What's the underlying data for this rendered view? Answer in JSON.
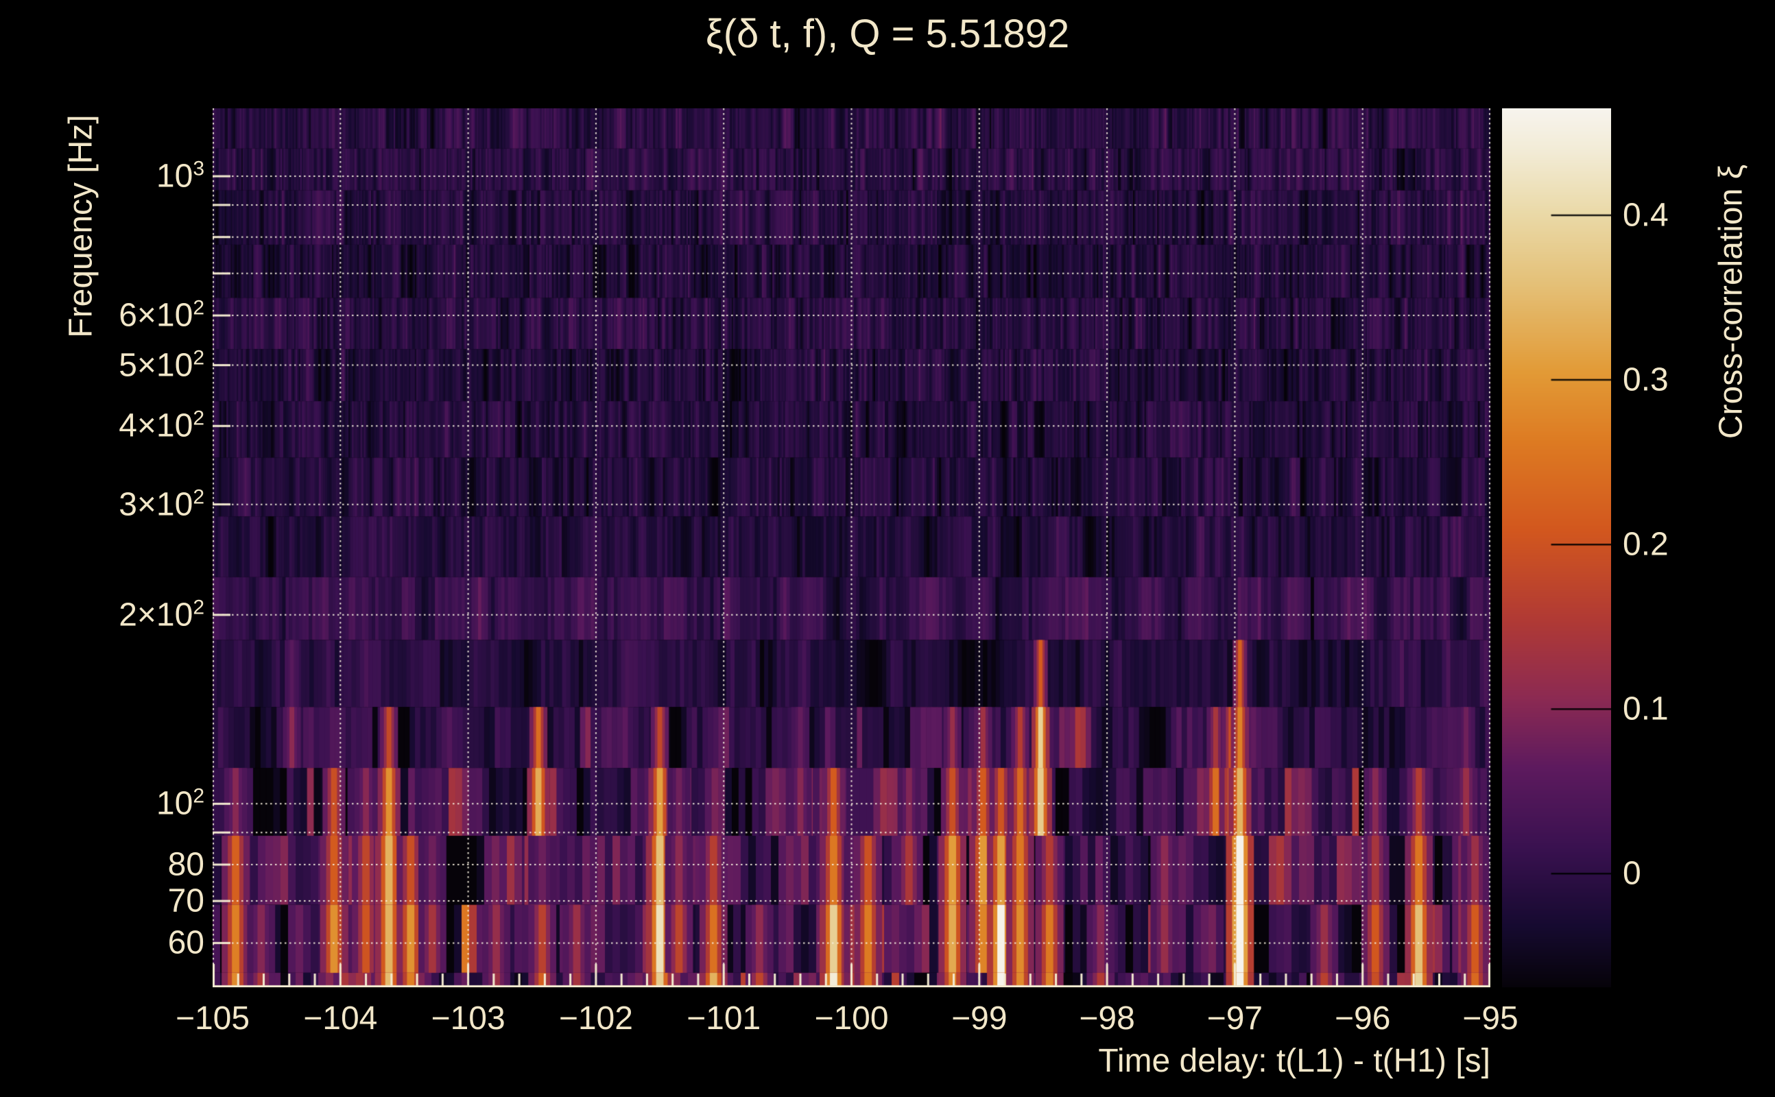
{
  "chart_data": {
    "type": "heatmap",
    "title": "ξ(δ t, f), Q = 5.51892",
    "xlabel": "Time delay: t(L1) - t(H1) [s]",
    "ylabel": "Frequency [Hz]",
    "x_range": [
      -105.0,
      -95.0
    ],
    "x_ticks": [
      {
        "t": -105,
        "label": "−105"
      },
      {
        "t": -104,
        "label": "−104"
      },
      {
        "t": -103,
        "label": "−103"
      },
      {
        "t": -102,
        "label": "−102"
      },
      {
        "t": -101,
        "label": "−101"
      },
      {
        "t": -100,
        "label": "−100"
      },
      {
        "t": -99,
        "label": "−99"
      },
      {
        "t": -98,
        "label": "−98"
      },
      {
        "t": -97,
        "label": "−97"
      },
      {
        "t": -96,
        "label": "−96"
      },
      {
        "t": -95,
        "label": "−95"
      }
    ],
    "x_minor_step": 0.2,
    "y_scale": "log",
    "y_range_hz": [
      51,
      1283
    ],
    "y_ticks": [
      {
        "f": 1000,
        "m": "10",
        "e": "3"
      },
      {
        "f": 600,
        "m": "6×10",
        "e": "2"
      },
      {
        "f": 500,
        "m": "5×10",
        "e": "2"
      },
      {
        "f": 400,
        "m": "4×10",
        "e": "2"
      },
      {
        "f": 300,
        "m": "3×10",
        "e": "2"
      },
      {
        "f": 200,
        "m": "2×10",
        "e": "2"
      },
      {
        "f": 100,
        "m": "10",
        "e": "2"
      },
      {
        "f": 80,
        "m": "80",
        "e": null
      },
      {
        "f": 70,
        "m": "70",
        "e": null
      },
      {
        "f": 60,
        "m": "60",
        "e": null
      }
    ],
    "y_gridlines_hz": [
      1000,
      900,
      800,
      700,
      600,
      500,
      400,
      300,
      200,
      100,
      90,
      80,
      70,
      60
    ],
    "grid_on": true,
    "colorbar": {
      "label": "Cross-correlation ξ",
      "ticks": [
        {
          "v": 0.0,
          "label": "0"
        },
        {
          "v": 0.1,
          "label": "0.1"
        },
        {
          "v": 0.2,
          "label": "0.2"
        },
        {
          "v": 0.3,
          "label": "0.3"
        },
        {
          "v": 0.4,
          "label": "0.4"
        }
      ],
      "vmin": -0.069,
      "vmax": 0.465
    },
    "colormap_stops": [
      [
        0.0,
        "#060309"
      ],
      [
        0.07,
        "#160a30"
      ],
      [
        0.16,
        "#3a1150"
      ],
      [
        0.25,
        "#5d1a5e"
      ],
      [
        0.33,
        "#8c2a52"
      ],
      [
        0.42,
        "#b13a34"
      ],
      [
        0.52,
        "#d2571e"
      ],
      [
        0.62,
        "#dd7a22"
      ],
      [
        0.7,
        "#e29a36"
      ],
      [
        0.8,
        "#e4c077"
      ],
      [
        0.88,
        "#ead9a7"
      ],
      [
        0.95,
        "#f2ebd5"
      ],
      [
        1.0,
        "#f7f4ee"
      ]
    ],
    "noise": {
      "seed": 1337,
      "base": -0.012,
      "sigma_high": 0.02,
      "sigma_mid": 0.035,
      "sigma_low": 0.052
    },
    "streaks": [
      {
        "t": -104.82,
        "f": [
          51,
          100
        ],
        "v": 0.26
      },
      {
        "t": -104.62,
        "f": [
          51,
          64
        ],
        "v": 0.16
      },
      {
        "t": -104.38,
        "f": [
          120,
          170
        ],
        "v": 0.1
      },
      {
        "t": -104.05,
        "f": [
          55,
          112
        ],
        "v": 0.28
      },
      {
        "t": -103.8,
        "f": [
          62,
          95
        ],
        "v": 0.22
      },
      {
        "t": -103.62,
        "f": [
          51,
          132
        ],
        "v": 0.4
      },
      {
        "t": -103.45,
        "f": [
          51,
          88
        ],
        "v": 0.3
      },
      {
        "t": -103.28,
        "f": [
          56,
          80
        ],
        "v": 0.16
      },
      {
        "t": -102.78,
        "f": [
          51,
          66
        ],
        "v": 0.15
      },
      {
        "t": -102.45,
        "f": [
          78,
          142
        ],
        "v": 0.38
      },
      {
        "t": -102.42,
        "f": [
          51,
          70
        ],
        "v": 0.2
      },
      {
        "t": -102.15,
        "f": [
          51,
          66
        ],
        "v": 0.16
      },
      {
        "t": -101.5,
        "f": [
          51,
          128
        ],
        "v": 0.4
      },
      {
        "t": -101.35,
        "f": [
          60,
          92
        ],
        "v": 0.16
      },
      {
        "t": -101.08,
        "f": [
          51,
          80
        ],
        "v": 0.3
      },
      {
        "t": -100.72,
        "f": [
          51,
          66
        ],
        "v": 0.16
      },
      {
        "t": -100.4,
        "f": [
          95,
          130
        ],
        "v": 0.12
      },
      {
        "t": -100.14,
        "f": [
          51,
          92
        ],
        "v": 0.42
      },
      {
        "t": -99.95,
        "f": [
          51,
          72
        ],
        "v": 0.24
      },
      {
        "t": -99.87,
        "f": [
          51,
          86
        ],
        "v": 0.28
      },
      {
        "t": -99.55,
        "f": [
          70,
          112
        ],
        "v": 0.15
      },
      {
        "t": -99.21,
        "f": [
          51,
          122
        ],
        "v": 0.32
      },
      {
        "t": -98.97,
        "f": [
          58,
          132
        ],
        "v": 0.3
      },
      {
        "t": -98.83,
        "f": [
          51,
          96
        ],
        "v": 0.46
      },
      {
        "t": -98.68,
        "f": [
          51,
          140
        ],
        "v": 0.28
      },
      {
        "t": -98.52,
        "f": [
          92,
          160
        ],
        "v": 0.44
      },
      {
        "t": -98.45,
        "f": [
          51,
          82
        ],
        "v": 0.28
      },
      {
        "t": -98.05,
        "f": [
          51,
          64
        ],
        "v": 0.14
      },
      {
        "t": -97.55,
        "f": [
          60,
          92
        ],
        "v": 0.13
      },
      {
        "t": -97.15,
        "f": [
          95,
          140
        ],
        "v": 0.22
      },
      {
        "t": -97.03,
        "f": [
          100,
          142
        ],
        "v": 0.24
      },
      {
        "t": -96.96,
        "f": [
          51,
          148
        ],
        "v": 0.47
      },
      {
        "t": -96.3,
        "f": [
          51,
          68
        ],
        "v": 0.16
      },
      {
        "t": -95.9,
        "f": [
          51,
          95
        ],
        "v": 0.22
      },
      {
        "t": -95.56,
        "f": [
          51,
          102
        ],
        "v": 0.34
      },
      {
        "t": -95.19,
        "f": [
          60,
          120
        ],
        "v": 0.16
      },
      {
        "t": -95.12,
        "f": [
          51,
          80
        ],
        "v": 0.22
      }
    ],
    "text_color": "#f2e7c9",
    "background_color": "#000000"
  }
}
